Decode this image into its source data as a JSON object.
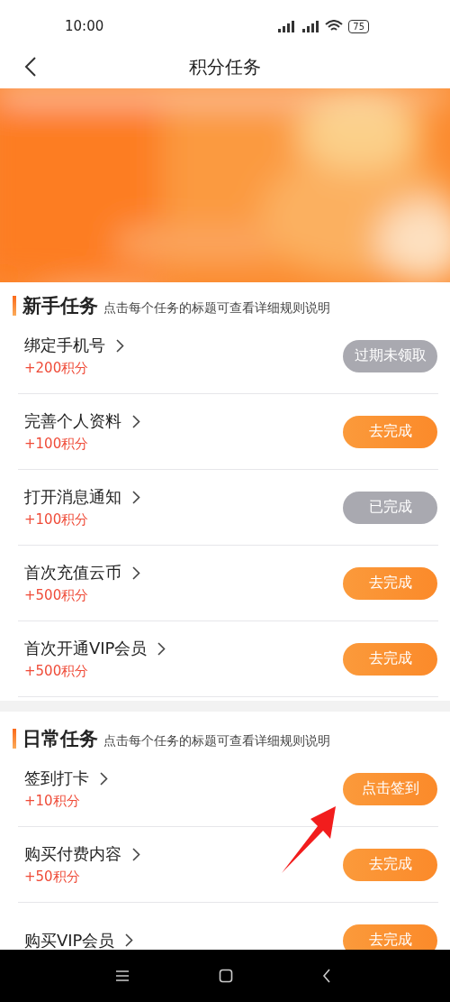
{
  "status_bar": {
    "time": "10:00",
    "battery": "75"
  },
  "header": {
    "title": "积分任务"
  },
  "sections": [
    {
      "title": "新手任务",
      "hint": "点击每个任务的标题可查看详细规则说明",
      "tasks": [
        {
          "title": "绑定手机号",
          "points": "+200积分",
          "button": "过期未领取",
          "kind": "expired"
        },
        {
          "title": "完善个人资料",
          "points": "+100积分",
          "button": "去完成",
          "kind": "go"
        },
        {
          "title": "打开消息通知",
          "points": "+100积分",
          "button": "已完成",
          "kind": "done"
        },
        {
          "title": "首次充值云币",
          "points": "+500积分",
          "button": "去完成",
          "kind": "go"
        },
        {
          "title": "首次开通VIP会员",
          "points": "+500积分",
          "button": "去完成",
          "kind": "go"
        }
      ]
    },
    {
      "title": "日常任务",
      "hint": "点击每个任务的标题可查看详细规则说明",
      "tasks": [
        {
          "title": "签到打卡",
          "points": "+10积分",
          "button": "点击签到",
          "kind": "go"
        },
        {
          "title": "购买付费内容",
          "points": "+50积分",
          "button": "去完成",
          "kind": "go"
        },
        {
          "title": "购买VIP会员",
          "button": "去完成",
          "kind": "go"
        }
      ]
    }
  ]
}
